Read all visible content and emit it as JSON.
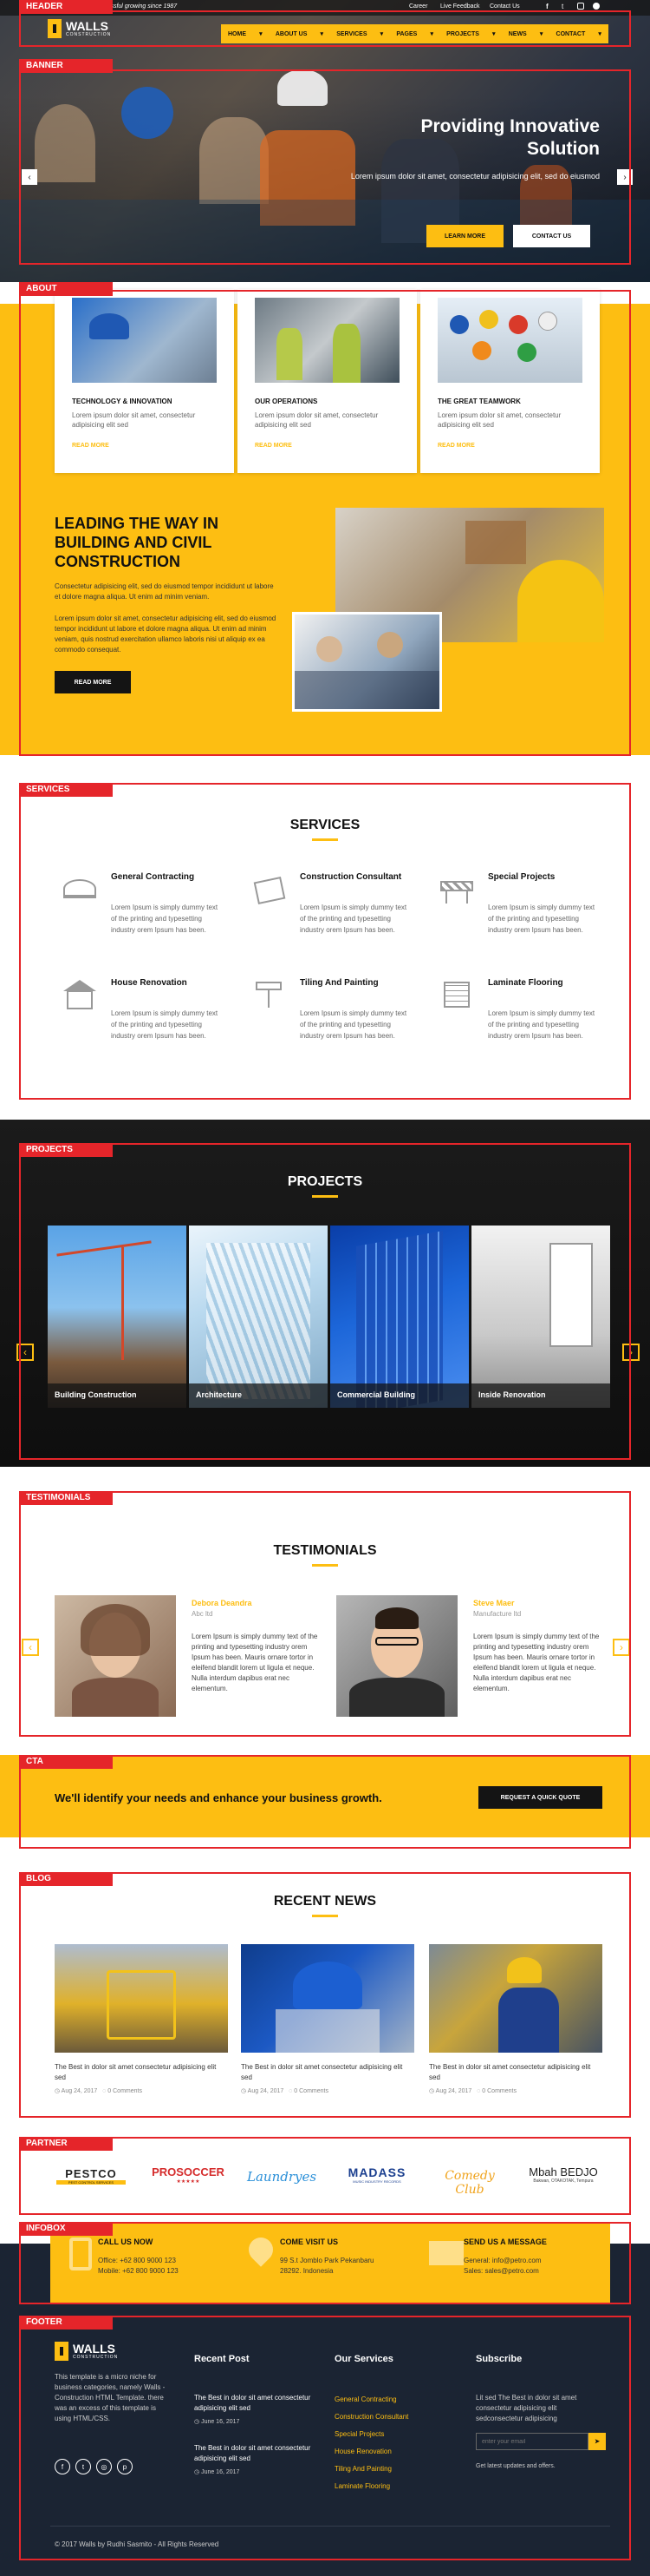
{
  "section_labels": {
    "header": "HEADER",
    "banner": "BANNER",
    "about": "ABOUT",
    "services": "SERVICES",
    "projects": "PROJECTS",
    "testimonials": "TESTIMONIALS",
    "cta": "CTA",
    "blog": "BLOG",
    "partner": "PARTNER",
    "infobox": "INFOBOX",
    "footer": "FOOTER"
  },
  "topbar": {
    "tagline": "Successful growing since 1987",
    "links": [
      "Career",
      "Live Feedback",
      "Contact Us"
    ],
    "social_icons": [
      "facebook-icon",
      "twitter-icon",
      "instagram-icon",
      "pinterest-icon"
    ]
  },
  "logo": {
    "name": "WALLS",
    "sub": "CONSTRUCTION"
  },
  "nav": [
    "HOME",
    "ABOUT US",
    "SERVICES",
    "PAGES",
    "PROJECTS",
    "NEWS",
    "CONTACT"
  ],
  "banner": {
    "title_line1": "Providing Innovative",
    "title_line2": "Solution",
    "text": "Lorem ipsum dolor sit amet, consectetur adipisicing elit, sed do eiusmod",
    "btn_learn": "LEARN MORE",
    "btn_contact": "CONTACT US"
  },
  "about_cards": [
    {
      "title": "TECHNOLOGY & INNOVATION",
      "text": "Lorem ipsum dolor sit amet, consectetur adipisicing elit sed",
      "link": "READ MORE"
    },
    {
      "title": "OUR OPERATIONS",
      "text": "Lorem ipsum dolor sit amet, consectetur adipisicing elit sed",
      "link": "READ MORE"
    },
    {
      "title": "THE GREAT TEAMWORK",
      "text": "Lorem ipsum dolor sit amet, consectetur adipisicing elit sed",
      "link": "READ MORE"
    }
  ],
  "about": {
    "heading_l1": "LEADING THE WAY IN",
    "heading_l2": "BUILDING AND CIVIL",
    "heading_l3": "CONSTRUCTION",
    "para1": "Consectetur adipisicing elit, sed do eiusmod tempor incididunt ut labore et dolore magna aliqua. Ut enim ad minim veniam.",
    "para2": "Lorem ipsum dolor sit amet, consectetur adipisicing elit, sed do eiusmod tempor incididunt ut labore et dolore magna aliqua. Ut enim ad minim veniam, quis nostrud exercitation ullamco laboris nisi ut aliquip ex ea commodo consequat.",
    "btn": "READ MORE"
  },
  "services": {
    "heading": "SERVICES",
    "items": [
      {
        "title": "General Contracting",
        "text": "Lorem Ipsum is simply dummy text of the printing and typesetting industry orem Ipsum has been.",
        "icon": "helmet-icon"
      },
      {
        "title": "Construction Consultant",
        "text": "Lorem Ipsum is simply dummy text of the printing and typesetting industry orem Ipsum has been.",
        "icon": "blueprint-icon"
      },
      {
        "title": "Special Projects",
        "text": "Lorem Ipsum is simply dummy text of the printing and typesetting industry orem Ipsum has been.",
        "icon": "barrier-icon"
      },
      {
        "title": "House Renovation",
        "text": "Lorem Ipsum is simply dummy text of the printing and typesetting industry orem Ipsum has been.",
        "icon": "house-icon"
      },
      {
        "title": "Tiling And Painting",
        "text": "Lorem Ipsum is simply dummy text of the printing and typesetting industry orem Ipsum has been.",
        "icon": "paint-roller-icon"
      },
      {
        "title": "Laminate Flooring",
        "text": "Lorem Ipsum is simply dummy text of the printing and typesetting industry orem Ipsum has been.",
        "icon": "flooring-icon"
      }
    ]
  },
  "projects": {
    "heading": "PROJECTS",
    "items": [
      "Building Construction",
      "Architecture",
      "Commercial Building",
      "Inside Renovation"
    ]
  },
  "testimonials": {
    "heading": "TESTIMONIALS",
    "items": [
      {
        "name": "Debora Deandra",
        "role": "Abc ltd",
        "text": "Lorem Ipsum is simply dummy text of the printing and typesetting industry orem Ipsum has been. Mauris ornare tortor in eleifend blandit lorem ut ligula et neque. Nulla interdum dapibus erat nec elementum."
      },
      {
        "name": "Steve Maer",
        "role": "Manufacture ltd",
        "text": "Lorem Ipsum is simply dummy text of the printing and typesetting industry orem Ipsum has been. Mauris ornare tortor in eleifend blandit lorem ut ligula et neque. Nulla interdum dapibus erat nec elementum."
      }
    ]
  },
  "cta": {
    "text": "We'll identify your needs and enhance your business growth.",
    "btn": "REQUEST A QUICK QUOTE"
  },
  "blog": {
    "heading": "RECENT NEWS",
    "items": [
      {
        "title": "The Best in dolor sit amet consectetur adipisicing elit sed",
        "date": "Aug 24, 2017",
        "comments": "0 Comments"
      },
      {
        "title": "The Best in dolor sit amet consectetur adipisicing elit sed",
        "date": "Aug 24, 2017",
        "comments": "0 Comments"
      },
      {
        "title": "The Best in dolor sit amet consectetur adipisicing elit sed",
        "date": "Aug 24, 2017",
        "comments": "0 Comments"
      }
    ]
  },
  "partners": [
    {
      "name": "PESTCO",
      "sub": "PEST CONTROL SERVICES"
    },
    {
      "name": "PROSOCCER",
      "sub": "★★★★★"
    },
    {
      "name": "Laundryes",
      "sub": ""
    },
    {
      "name": "MADASS",
      "sub": "MUSIC INDUSTRY RECORDS"
    },
    {
      "name": "Comedy Club",
      "sub": ""
    },
    {
      "name": "Mbah BEDJO",
      "sub": "Bakwan, OTAKOTAK, Tempura"
    }
  ],
  "infobox": [
    {
      "title": "CALL US NOW",
      "l1": "Office: +62 800 9000 123",
      "l2": "Mobile: +62 800 9000 123",
      "icon": "phone-icon"
    },
    {
      "title": "COME VISIT US",
      "l1": "99 S.t Jomblo Park Pekanbaru",
      "l2": "28292. Indonesia",
      "icon": "map-pin-icon"
    },
    {
      "title": "SEND US A MESSAGE",
      "l1": "General: info@petro.com",
      "l2": "Sales: sales@petro.com",
      "icon": "envelope-icon"
    }
  ],
  "footer": {
    "about": "This template is a micro niche for business categories, namely Walls - Construction HTML Template. there was an excess of this template is using HTML/CSS.",
    "recent_title": "Recent Post",
    "recent_posts": [
      {
        "title": "The Best in dolor sit amet consectetur adipisicing elit sed",
        "date": "June 16, 2017"
      },
      {
        "title": "The Best in dolor sit amet consectetur adipisicing elit sed",
        "date": "June 16, 2017"
      }
    ],
    "services_title": "Our Services",
    "services": [
      "General Contracting",
      "Construction Consultant",
      "Special Projects",
      "House Renovation",
      "Tiling And Painting",
      "Laminate Flooring"
    ],
    "subscribe_title": "Subscribe",
    "subscribe_text": "Lit sed The Best in dolor sit amet consectetur adipisicing elit sedconsectetur adipisicing",
    "email_placeholder": "enter your email",
    "subscribe_note": "Get latest updates and offers.",
    "copyright": "© 2017 Walls by Rudhi Sasmito - All Rights Reserved"
  },
  "colors": {
    "accent": "#fdbe12",
    "dark": "#141414",
    "label_red": "#e5252a"
  }
}
